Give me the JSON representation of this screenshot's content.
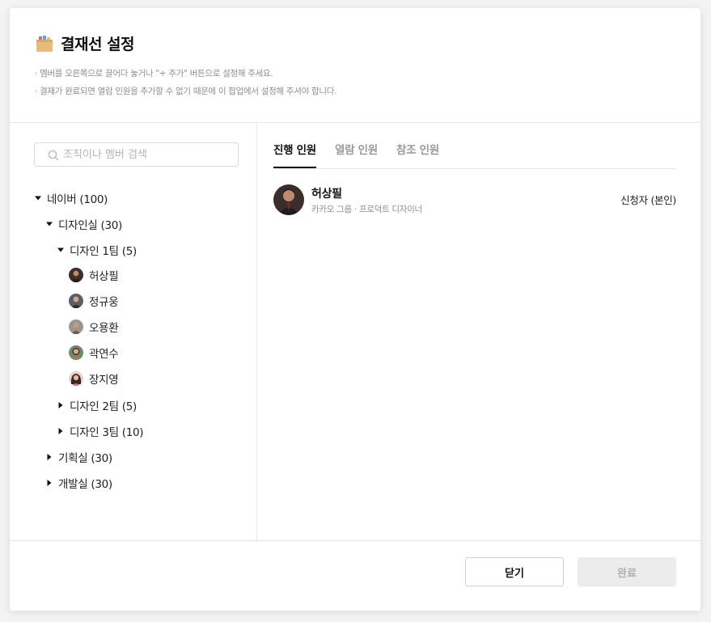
{
  "header": {
    "title": "결재선 설정",
    "descriptions": [
      "· 멤버를 오른쪽으로 끌어다 놓거나 \"+ 추가\" 버튼으로 설정해 주세요.",
      "· 결재가 완료되면 열람 인원을 추가할 수 없기 때문에 이 팝업에서 설정해 주셔야 합니다."
    ]
  },
  "search": {
    "placeholder": "조직이나 멤버 검색"
  },
  "tree": {
    "root": "네이버 (100)",
    "design_dept": "디자인실 (30)",
    "design_team1": "디자인 1팀 (5)",
    "members": [
      "허상필",
      "정규웅",
      "오용환",
      "곽연수",
      "장지영"
    ],
    "design_team2": "디자인 2팀 (5)",
    "design_team3": "디자인 3팀 (10)",
    "planning": "기획실 (30)",
    "dev": "개발실 (30)"
  },
  "tabs": [
    "진행 인원",
    "열람 인원",
    "참조 인원"
  ],
  "active_tab": "진행 인원",
  "selected": [
    {
      "name": "허상필",
      "org": "카카오 그룹 ·  프로덕트 디자이너",
      "role": "신청자 (본인)"
    }
  ],
  "buttons": {
    "close": "닫기",
    "done": "완료"
  },
  "colors": {
    "active_text": "#111111",
    "muted_text": "#8e8e8e",
    "disabled_bg": "#ececec"
  }
}
